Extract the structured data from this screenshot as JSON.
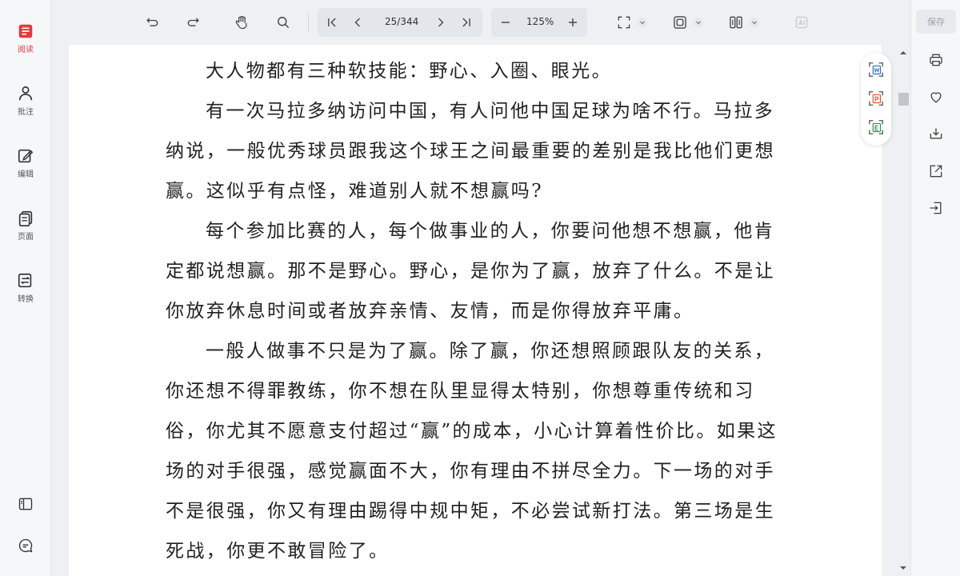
{
  "sidebar": {
    "items": [
      {
        "label": "阅读",
        "icon": "book-icon",
        "active": true
      },
      {
        "label": "批注",
        "icon": "annotate-icon",
        "active": false
      },
      {
        "label": "编辑",
        "icon": "edit-icon",
        "active": false
      },
      {
        "label": "页面",
        "icon": "pages-icon",
        "active": false
      },
      {
        "label": "转换",
        "icon": "convert-icon",
        "active": false
      }
    ],
    "bottom": [
      {
        "icon": "panel-layout-icon"
      },
      {
        "icon": "chat-icon"
      }
    ]
  },
  "toolbar": {
    "page_indicator": "25/344",
    "current_page": 25,
    "total_pages": 344,
    "zoom": "125%"
  },
  "right_sidebar": {
    "save_label": "保存",
    "buttons": [
      "print-icon",
      "favorite-icon",
      "download-icon",
      "share-icon",
      "exit-icon"
    ]
  },
  "export_panel": [
    "export-word-icon",
    "export-ppt-icon",
    "export-excel-icon"
  ],
  "document": {
    "paragraphs": [
      "大人物都有三种软技能：野心、入圈、眼光。",
      "有一次马拉多纳访问中国，有人问他中国足球为啥不行。马拉多纳说，一般优秀球员跟我这个球王之间最重要的差别是我比他们更想赢。这似乎有点怪，难道别人就不想赢吗?",
      "每个参加比赛的人，每个做事业的人，你要问他想不想赢，他肯定都说想赢。那不是野心。野心，是你为了赢，放弃了什么。不是让你放弃休息时间或者放弃亲情、友情，而是你得放弃平庸。",
      "一般人做事不只是为了赢。除了赢，你还想照顾跟队友的关系，你还想不得罪教练，你不想在队里显得太特别，你想尊重传统和习俗，你尤其不愿意支付超过“赢”的成本，小心计算着性价比。如果这场的对手很强，感觉赢面不大，你有理由不拼尽全力。下一场的对手不是很强，你又有理由踢得中规中矩，不必尝试新打法。第三场是生死战，你更不敢冒险了。"
    ]
  },
  "colors": {
    "accent": "#e5393d",
    "page": "#ffffff",
    "background": "#eef0f3"
  }
}
